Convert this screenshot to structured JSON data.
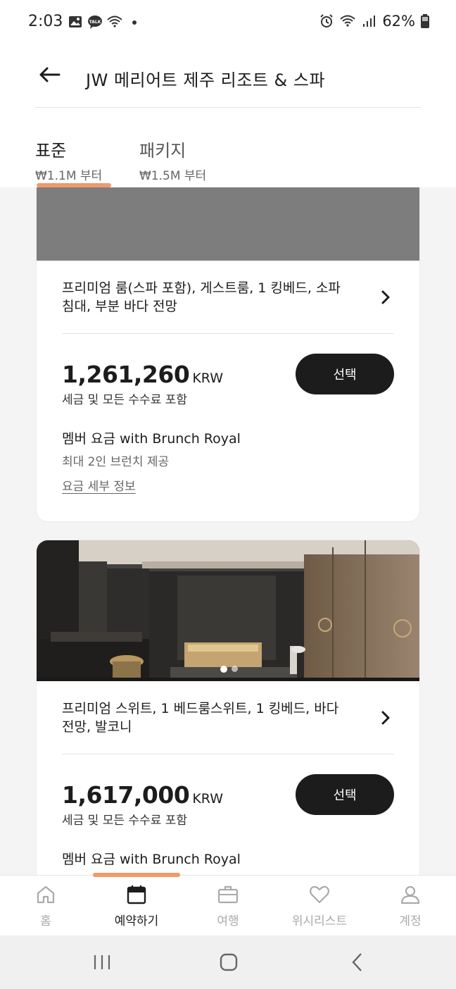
{
  "status_bar": {
    "time": "2:03",
    "battery": "62%",
    "left_icons": [
      "gallery-icon",
      "talk-icon",
      "wifi-question-icon",
      "dot-icon"
    ],
    "right_icons": [
      "alarm-icon",
      "wifi-icon",
      "signal-icon",
      "battery-icon"
    ]
  },
  "header": {
    "title": "JW 메리어트 제주 리조트 & 스파",
    "back_icon": "arrow-left-icon"
  },
  "tabs": [
    {
      "label": "표준",
      "sub": "₩1.1M 부터",
      "active": true
    },
    {
      "label": "패키지",
      "sub": "₩1.5M 부터",
      "active": false
    }
  ],
  "cards": [
    {
      "room_title": "프리미엄 룸(스파 포함), 게스트룸, 1 킹베드, 소파 침대, 부분 바다 전망",
      "price": "1,261,260",
      "currency": "KRW",
      "price_note": "세금 및 모든 수수료 포함",
      "select_label": "선택",
      "rate_name": "멤버 요금 with Brunch Royal",
      "rate_desc": "최대 2인 브런치 제공",
      "rate_link": "요금 세부 정보"
    },
    {
      "room_title": "프리미엄 스위트, 1 베드룸스위트, 1 킹베드, 바다 전망, 발코니",
      "price": "1,617,000",
      "currency": "KRW",
      "price_note": "세금 및 모든 수수료 포함",
      "select_label": "선택",
      "rate_name": "멤버 요금 with Brunch Royal",
      "carousel_pages": 2,
      "carousel_active": 1
    }
  ],
  "bottom_nav": [
    {
      "label": "홈",
      "icon": "home-icon",
      "active": false
    },
    {
      "label": "예약하기",
      "icon": "calendar-icon",
      "active": true
    },
    {
      "label": "여행",
      "icon": "suitcase-icon",
      "active": false
    },
    {
      "label": "위시리스트",
      "icon": "heart-icon",
      "active": false
    },
    {
      "label": "계정",
      "icon": "person-icon",
      "active": false
    }
  ],
  "system_nav": [
    "recents-icon",
    "home-button-icon",
    "back-icon"
  ],
  "colors": {
    "accent": "#f09a6c",
    "dark": "#1c1c1c",
    "muted": "#aaaaaa"
  }
}
